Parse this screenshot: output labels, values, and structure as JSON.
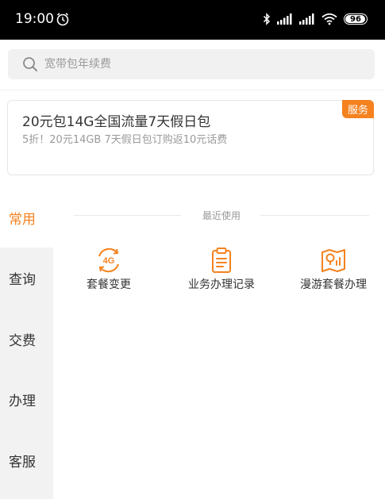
{
  "status_bar": {
    "time": "19:00",
    "battery": "96",
    "battery_level": 0.96,
    "icons": [
      "alarm-icon",
      "bluetooth-icon",
      "signal-icon",
      "signal-icon",
      "wifi-icon",
      "battery-icon"
    ]
  },
  "search": {
    "placeholder": "宽带包年续费",
    "icon": "search-icon"
  },
  "promo": {
    "title": "20元包14G全国流量7天假日包",
    "subtitle": "5折！20元14GB 7天假日包订购返10元话费",
    "badge": "服务"
  },
  "sidebar": {
    "items": [
      {
        "label": "常用",
        "active": true
      },
      {
        "label": "查询",
        "active": false
      },
      {
        "label": "交费",
        "active": false
      },
      {
        "label": "办理",
        "active": false
      },
      {
        "label": "客服",
        "active": false
      }
    ]
  },
  "recent": {
    "title": "最近使用",
    "items": [
      {
        "label": "套餐变更",
        "icon": "4g-package-icon"
      },
      {
        "label": "业务办理记录",
        "icon": "clipboard-icon"
      },
      {
        "label": "漫游套餐办理",
        "icon": "roaming-map-icon"
      }
    ]
  },
  "colors": {
    "accent": "#f5821f",
    "status_bar_bg": "#000000",
    "sidebar_bg": "#f2f2f2"
  }
}
